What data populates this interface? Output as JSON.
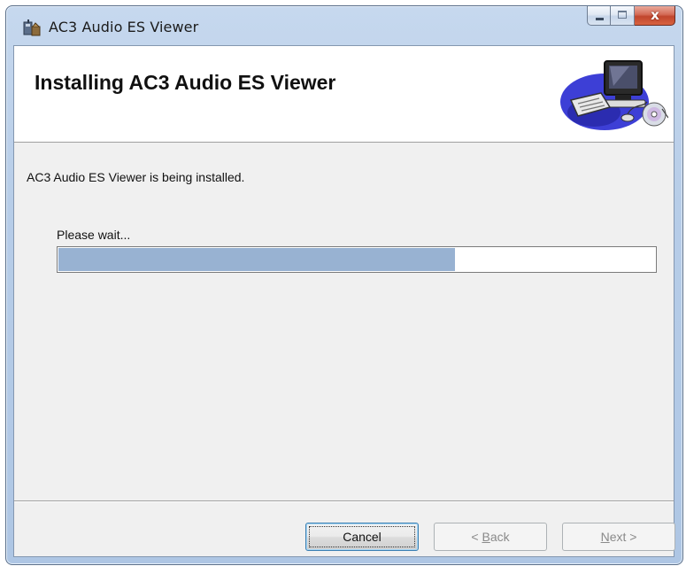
{
  "window": {
    "title": "AC3 Audio ES Viewer",
    "caption_buttons": {
      "minimize": "minimize-icon",
      "maximize": "maximize-icon",
      "close": "close-icon",
      "close_glyph": "x"
    }
  },
  "banner": {
    "title": "Installing AC3 Audio ES Viewer",
    "art_icon": "computer-with-cd-icon"
  },
  "body": {
    "status_text": "AC3 Audio ES Viewer is being installed.",
    "progress_label": "Please wait...",
    "progress_fraction": 0.665
  },
  "buttons": {
    "cancel": "Cancel",
    "back_prefix": "< ",
    "back_accel": "B",
    "back_rest": "ack",
    "next_accel": "N",
    "next_rest": "ext >"
  },
  "colors": {
    "progress_fill": "#98b2d2",
    "dialog_bg": "#f0f0f0",
    "close_button": "#c0452d"
  }
}
